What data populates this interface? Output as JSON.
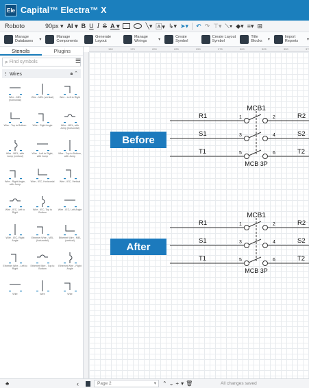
{
  "window": {
    "title": "Capital™ Electra™ X",
    "app_icon": "Ele"
  },
  "formatbar": {
    "font": "Roboto",
    "size": "90px",
    "items": [
      "AI",
      "B",
      "U",
      "I",
      "S",
      "A"
    ]
  },
  "ribbon": [
    {
      "icon": "database-icon",
      "label": "Manage Databases"
    },
    {
      "icon": "components-icon",
      "label": "Manage Components"
    },
    {
      "icon": "layout-icon",
      "label": "Generate Layout"
    },
    {
      "icon": "wirings-icon",
      "label": "Manage Wirings"
    },
    {
      "icon": "symbol-icon",
      "label": "Create Symbol"
    },
    {
      "icon": "layout-symbol-icon",
      "label": "Create Layout Symbol"
    },
    {
      "icon": "title-blocks-icon",
      "label": "Title Blocks"
    },
    {
      "icon": "reports-icon",
      "label": "Import Reports"
    }
  ],
  "ruler_ticks": [
    "150",
    "175",
    "200",
    "225",
    "250",
    "275",
    "300",
    "325",
    "350",
    "375"
  ],
  "panel": {
    "tabs": [
      "Stencils",
      "Plugins"
    ],
    "search_placeholder": "Find symbols",
    "group": "Wires",
    "symbols": [
      "Wire - MEL (horizontal)",
      "Wire - MEL (vertical)",
      "Wire - Left to Right",
      "Wire - Top to Bottom",
      "Wire - Right Angle",
      "Wire - MEL, with Jump (horizontal)",
      "Wire - MEL, with Jump (vertical)",
      "Wire - Left to Right, with Jump",
      "Wire - Top to Bottom, with Jump",
      "Wire - Right Angle, with Jump",
      "Wire - IEC, Horizontal",
      "Wire - IEC, Vertical",
      "Wire - IEC, Left to Right",
      "Wire - IEC, Top to Bottom",
      "Wire - IEC, Left Angle",
      "Wire - IEC, Right Angle",
      "Ethernet Wire - MEL (horizontal)",
      "Ethernet Wire - MEL (vertical)",
      "Ethernet Wire - Left to Right",
      "Ethernet Wire - Top to Bottom",
      "Ethernet Wire - Right Angle",
      "Wire",
      "Wire",
      "Wire"
    ]
  },
  "canvas": {
    "before_label": "Before",
    "after_label": "After",
    "breaker_ref": "MCB1",
    "breaker_type": "MCB 3P",
    "left_labels": [
      "R1",
      "S1",
      "T1"
    ],
    "right_labels": [
      "R2",
      "S2",
      "T2"
    ],
    "in_pins": [
      "1",
      "3",
      "5"
    ],
    "out_pins": [
      "2",
      "4",
      "6"
    ],
    "accent_color": "#1c7abd"
  },
  "statusbar": {
    "page": "Page 2",
    "status": "All changes saved"
  }
}
